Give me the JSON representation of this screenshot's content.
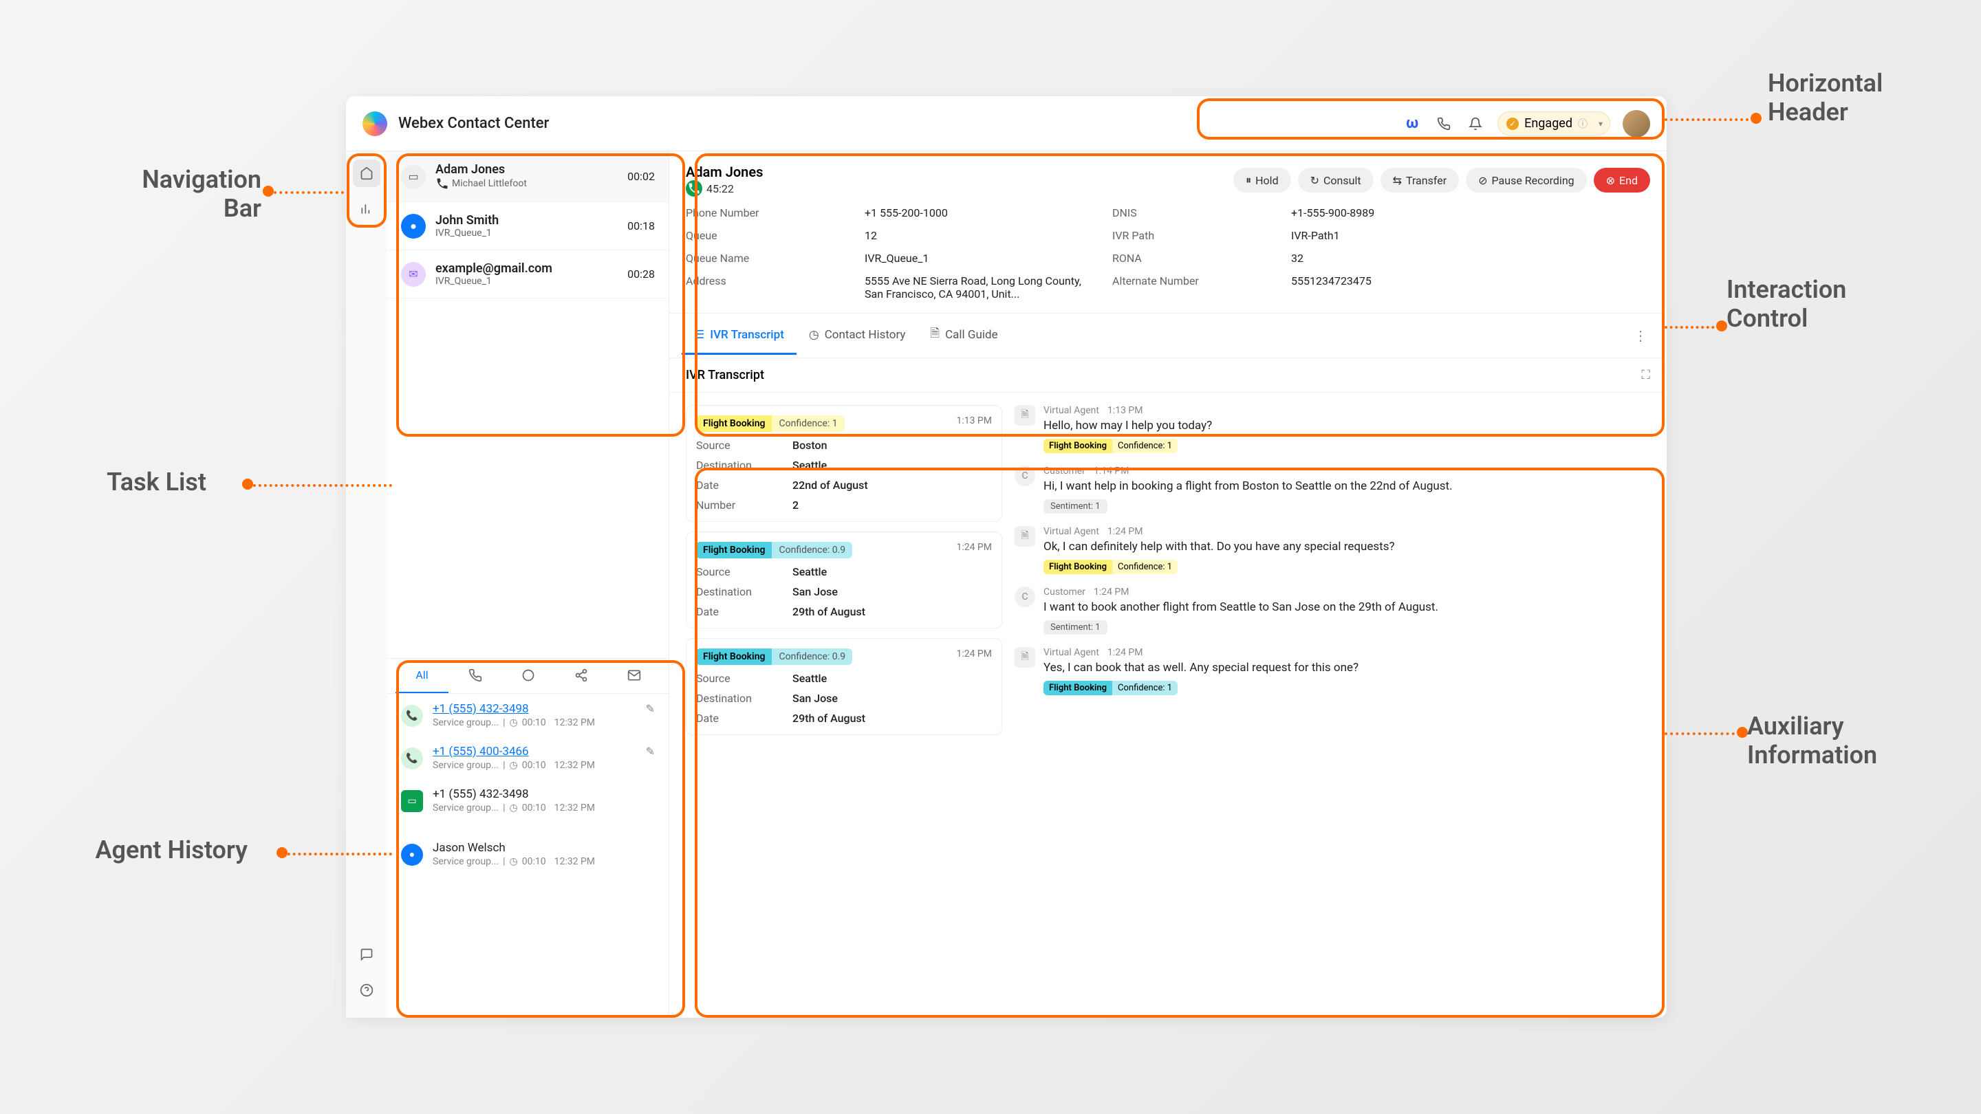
{
  "header": {
    "title": "Webex Contact Center",
    "status": "Engaged"
  },
  "tasks": [
    {
      "name": "Adam Jones",
      "sub": "Michael Littlefoot",
      "time": "00:02",
      "icon": "contact"
    },
    {
      "name": "John Smith",
      "sub": "IVR_Queue_1",
      "time": "00:18",
      "icon": "chat"
    },
    {
      "name": "example@gmail.com",
      "sub": "IVR_Queue_1",
      "time": "00:28",
      "icon": "mail"
    }
  ],
  "history_tabs": {
    "all": "All"
  },
  "history": [
    {
      "title": "+1 (555) 432-3498",
      "meta": "Service group...",
      "dur": "00:10",
      "ts": "12:32 PM",
      "icon": "green",
      "link": true,
      "edit": true
    },
    {
      "title": "+1 (555) 400-3466",
      "meta": "Service group...",
      "dur": "00:10",
      "ts": "12:32 PM",
      "icon": "green",
      "link": true,
      "edit": true
    },
    {
      "title": "+1 (555) 432-3498",
      "meta": "Service group...",
      "dur": "00:10",
      "ts": "12:32 PM",
      "icon": "msg",
      "link": false
    },
    {
      "title": "Jason Welsch",
      "meta": "Service group...",
      "dur": "00:10",
      "ts": "12:32 PM",
      "icon": "blue",
      "link": false
    }
  ],
  "interaction": {
    "name": "Adam Jones",
    "timer": "45:22",
    "buttons": {
      "hold": "Hold",
      "consult": "Consult",
      "transfer": "Transfer",
      "pause": "Pause Recording",
      "end": "End"
    },
    "fields": {
      "phone_l": "Phone Number",
      "phone_v": "+1 555-200-1000",
      "queue_l": "Queue",
      "queue_v": "12",
      "qname_l": "Queue Name",
      "qname_v": "IVR_Queue_1",
      "addr_l": "Address",
      "addr_v": "5555 Ave NE Sierra Road, Long Long County, San Francisco, CA 94001, Unit...",
      "dnis_l": "DNIS",
      "dnis_v": "+1-555-900-8989",
      "ivr_l": "IVR Path",
      "ivr_v": "IVR-Path1",
      "rona_l": "RONA",
      "rona_v": "32",
      "alt_l": "Alternate Number",
      "alt_v": "5551234723475"
    }
  },
  "aux": {
    "tabs": {
      "ivr": "IVR Transcript",
      "contact": "Contact History",
      "guide": "Call Guide"
    },
    "title": "IVR Transcript"
  },
  "ivr_cards": [
    {
      "intent": "Flight Booking",
      "conf": "Confidence: 1",
      "time": "1:13 PM",
      "chip": "yellow",
      "rows": [
        [
          "Source",
          "Boston"
        ],
        [
          "Destination",
          "Seattle"
        ],
        [
          "Date",
          "22nd of August"
        ],
        [
          "Number",
          "2"
        ]
      ]
    },
    {
      "intent": "Flight Booking",
      "conf": "Confidence: 0.9",
      "time": "1:24 PM",
      "chip": "teal",
      "rows": [
        [
          "Source",
          "Seattle"
        ],
        [
          "Destination",
          "San Jose"
        ],
        [
          "Date",
          "29th of August"
        ]
      ]
    },
    {
      "intent": "Flight Booking",
      "conf": "Confidence: 0.9",
      "time": "1:24 PM",
      "chip": "teal",
      "rows": [
        [
          "Source",
          "Seattle"
        ],
        [
          "Destination",
          "San Jose"
        ],
        [
          "Date",
          "29th of August"
        ]
      ]
    }
  ],
  "messages": [
    {
      "who": "Virtual Agent",
      "time": "1:13 PM",
      "ico": "va",
      "text": "Hello, how may I help you today?",
      "chips": [
        {
          "t": "yellow",
          "a": "Flight Booking",
          "b": "Confidence: 1"
        }
      ]
    },
    {
      "who": "Customer",
      "time": "1:14 PM",
      "ico": "c",
      "text": "Hi, I want help in booking a flight from Boston to Seattle on the 22nd of August.",
      "chips": [
        {
          "t": "gray",
          "a": "Sentiment: 1"
        }
      ]
    },
    {
      "who": "Virtual Agent",
      "time": "1:24 PM",
      "ico": "va",
      "text": "Ok, I can definitely help with that. Do you have any special requests?",
      "chips": [
        {
          "t": "yellow",
          "a": "Flight Booking",
          "b": "Confidence: 1"
        }
      ]
    },
    {
      "who": "Customer",
      "time": "1:24 PM",
      "ico": "c",
      "text": "I want to book another flight from Seattle to San Jose on the 29th of August.",
      "chips": [
        {
          "t": "gray",
          "a": "Sentiment: 1"
        }
      ]
    },
    {
      "who": "Virtual Agent",
      "time": "1:24 PM",
      "ico": "va",
      "text": "Yes, I can book that as well. Any special request for this one?",
      "chips": [
        {
          "t": "teal",
          "a": "Flight Booking",
          "b": "Confidence: 1"
        }
      ]
    }
  ],
  "callouts": {
    "nav": "Navigation\nBar",
    "task": "Task List",
    "agent": "Agent History",
    "header": "Horizontal\nHeader",
    "interaction": "Interaction\nControl",
    "aux": "Auxiliary\nInformation"
  }
}
